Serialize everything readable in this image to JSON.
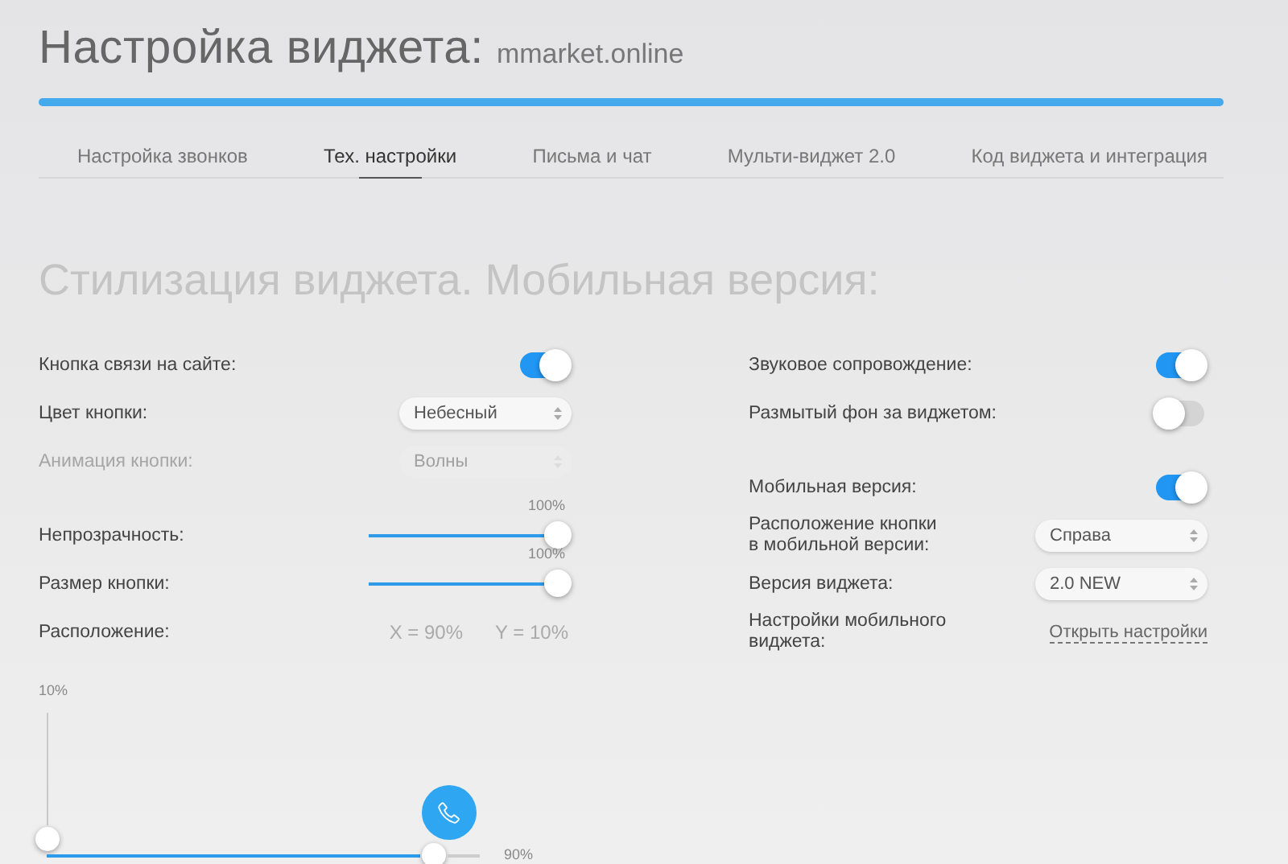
{
  "title": "Настройка виджета:",
  "site": "mmarket.online",
  "tabs": [
    {
      "label": "Настройка звонков",
      "selected": false
    },
    {
      "label": "Тех. настройки",
      "selected": true
    },
    {
      "label": "Письма и чат",
      "selected": false
    },
    {
      "label": "Мульти-виджет 2.0",
      "selected": false
    },
    {
      "label": "Код виджета и интеграция",
      "selected": false
    }
  ],
  "section_title": "Стилизация виджета. Мобильная версия:",
  "left_rows": [
    {
      "kind": "toggle",
      "label": "Кнопка связи на сайте:",
      "on": true
    },
    {
      "kind": "select",
      "label": "Цвет кнопки:",
      "value": "Небесный",
      "disabled": false
    },
    {
      "kind": "select",
      "label": "Анимация кнопки:",
      "value": "Волны",
      "disabled": true
    },
    {
      "kind": "spacer"
    },
    {
      "kind": "slider",
      "label": "Непрозрачность:",
      "level": 1,
      "reading": "100%"
    },
    {
      "kind": "slider",
      "label": "Размер кнопки:",
      "level": 1,
      "reading": "100%"
    },
    {
      "kind": "readout",
      "label": "Расположение:",
      "x": "X = 90%",
      "y": "Y = 10%"
    }
  ],
  "position": {
    "y_reading": "10%",
    "x_reading": "90%"
  },
  "right_rows": [
    {
      "kind": "toggle",
      "label": "Звуковое сопровождение:",
      "on": true
    },
    {
      "kind": "toggle",
      "label": "Размытый фон за виджетом:",
      "on": false
    },
    {
      "kind": "spacer"
    },
    {
      "kind": "toggle",
      "label": "Мобильная версия:",
      "on": true
    },
    {
      "kind": "select",
      "label": "Расположение кнопки\nв мобильной версии:",
      "value": "Справа",
      "disabled": false
    },
    {
      "kind": "select",
      "label": "Версия виджета:",
      "value": "2.0 NEW",
      "disabled": false
    },
    {
      "kind": "link",
      "label": "Настройки мобильного\nвиджета:",
      "link": "Открыть настройки"
    }
  ]
}
